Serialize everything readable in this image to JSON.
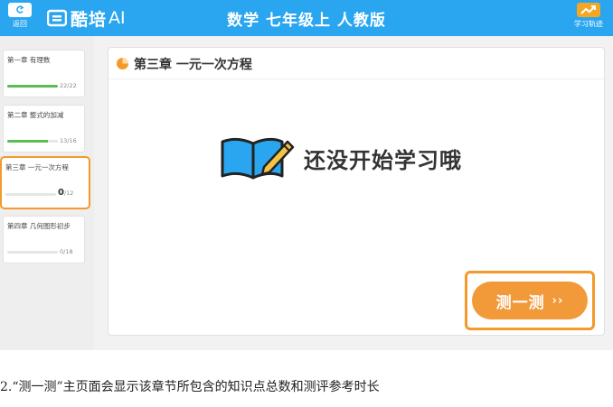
{
  "topbar": {
    "back_label": "返回",
    "brand": "酷培",
    "brand_suffix": "AI",
    "title": "数学 七年级上 人教版",
    "track_label": "学习轨迹",
    "color": "#29a6ef"
  },
  "sidebar": {
    "chapters": [
      {
        "title": "第一章 有理数",
        "count": "22/22",
        "progress": 1.0,
        "active": false
      },
      {
        "title": "第二章 整式的加减",
        "count": "13/16",
        "progress": 0.81,
        "active": false
      },
      {
        "title": "第三章 一元一次方程",
        "count_done": "0",
        "count_total": "/12",
        "progress": 0.0,
        "active": true
      },
      {
        "title": "第四章 几何图形初步",
        "count": "0/18",
        "progress": 0.0,
        "active": false
      }
    ]
  },
  "content": {
    "chapter_title": "第三章 一元一次方程",
    "empty_message": "还没开始学习哦",
    "test_button": "测一测",
    "test_button_arrows": "››",
    "accent": "#f39a2a"
  },
  "caption": "2.“测一测”主页面会显示该章节所包含的知识点总数和测评参考时长"
}
